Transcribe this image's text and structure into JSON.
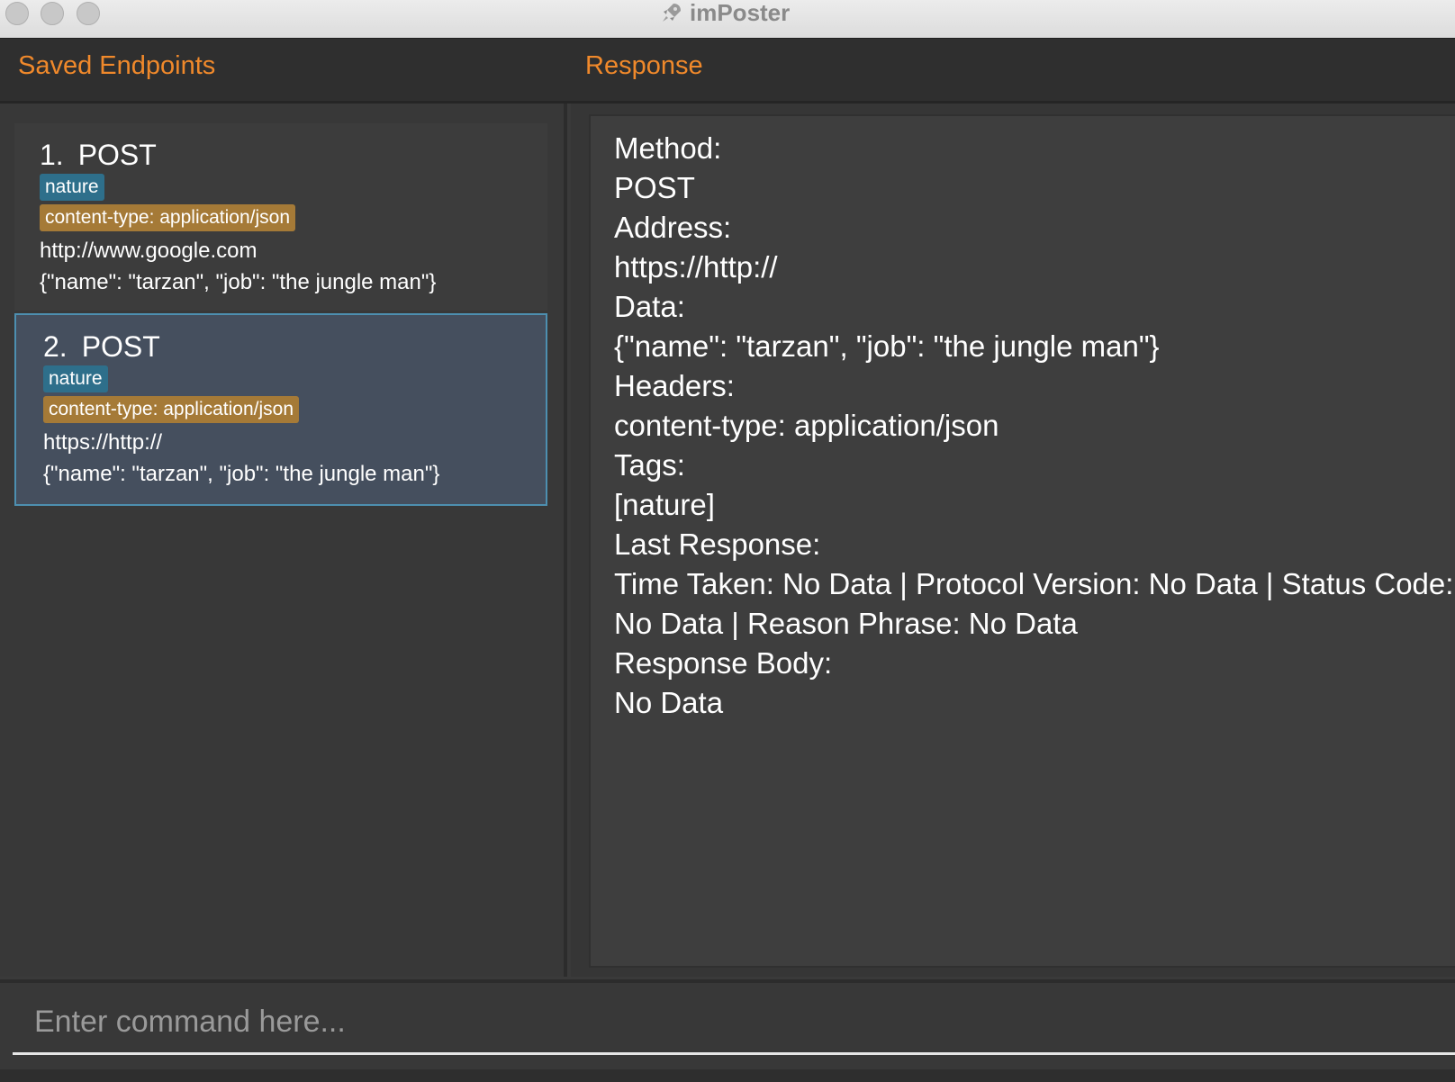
{
  "window": {
    "title": "imPoster"
  },
  "header": {
    "left_title": "Saved Endpoints",
    "right_title": "Response"
  },
  "endpoints": [
    {
      "index": "1.",
      "method": "POST",
      "tag": "nature",
      "header": "content-type: application/json",
      "address": "http://www.google.com",
      "data": "{\"name\": \"tarzan\", \"job\": \"the jungle man\"}",
      "selected": false
    },
    {
      "index": "2.",
      "method": "POST",
      "tag": "nature",
      "header": "content-type: application/json",
      "address": "https://http://",
      "data": "{\"name\": \"tarzan\", \"job\": \"the jungle man\"}",
      "selected": true
    }
  ],
  "response": {
    "lines": [
      "Method:",
      "POST",
      "Address:",
      "https://http://",
      "Data:",
      "{\"name\": \"tarzan\", \"job\": \"the jungle man\"}",
      "Headers:",
      "content-type: application/json",
      "Tags:",
      "[nature]",
      "Last Response:",
      "Time Taken: No Data | Protocol Version: No Data | Status Code:",
      "No Data | Reason Phrase: No Data",
      "Response Body:",
      "No Data"
    ]
  },
  "command": {
    "placeholder": "Enter command here...",
    "value": ""
  },
  "colors": {
    "accent": "#f0892b",
    "tag_chip": "#2e6f8b",
    "header_chip": "#a57a37",
    "selected_card": "#454f5e",
    "selected_border": "#4d8fb0"
  },
  "icons": {
    "app": "rocket-icon"
  }
}
